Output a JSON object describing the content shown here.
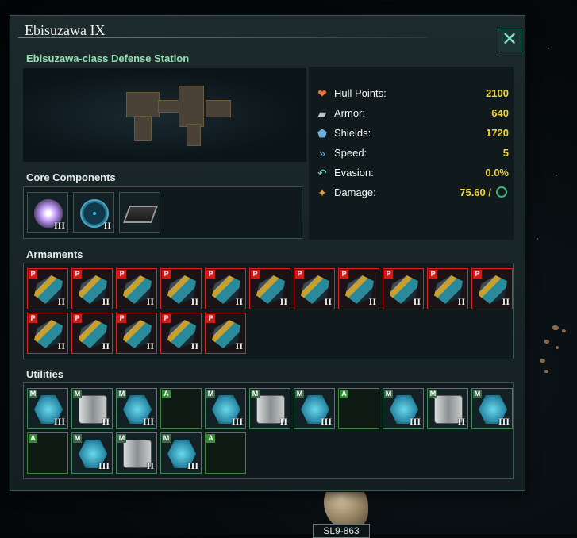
{
  "window": {
    "title": "Ebisuzawa IX",
    "close_label": "✕",
    "subtitle": "Ebisuzawa-class Defense Station"
  },
  "stats": [
    {
      "label": "Hull Points:",
      "value": "2100",
      "icon": "heart-icon",
      "glyph": "❤",
      "color": "#e8743a"
    },
    {
      "label": "Armor:",
      "value": "640",
      "icon": "armor-plate-icon",
      "glyph": "▰",
      "color": "#b8c4c4"
    },
    {
      "label": "Shields:",
      "value": "1720",
      "icon": "shield-icon",
      "glyph": "⬟",
      "color": "#6ab0d8"
    },
    {
      "label": "Speed:",
      "value": "5",
      "icon": "speed-icon",
      "glyph": "»",
      "color": "#8ab8e8"
    },
    {
      "label": "Evasion:",
      "value": "0.0%",
      "icon": "evasion-icon",
      "glyph": "↶",
      "color": "#6ad0b0"
    },
    {
      "label": "Damage:",
      "value": "75.60 /",
      "icon": "damage-icon",
      "glyph": "✦",
      "color": "#e8a040"
    }
  ],
  "sections": {
    "core": "Core Components",
    "armaments": "Armaments",
    "utilities": "Utilities"
  },
  "core_components": [
    {
      "icon": "reactor-icon",
      "tier": "III"
    },
    {
      "icon": "sensor-icon",
      "tier": "II"
    },
    {
      "icon": "computer-chip-icon",
      "tier": ""
    }
  ],
  "armaments": [
    {
      "badge": "P",
      "tier": "II"
    },
    {
      "badge": "P",
      "tier": "II"
    },
    {
      "badge": "P",
      "tier": "II"
    },
    {
      "badge": "P",
      "tier": "II"
    },
    {
      "badge": "P",
      "tier": "II"
    },
    {
      "badge": "P",
      "tier": "II"
    },
    {
      "badge": "P",
      "tier": "II"
    },
    {
      "badge": "P",
      "tier": "II"
    },
    {
      "badge": "P",
      "tier": "II"
    },
    {
      "badge": "P",
      "tier": "II"
    },
    {
      "badge": "P",
      "tier": "II"
    },
    {
      "badge": "P",
      "tier": "II"
    },
    {
      "badge": "P",
      "tier": "II"
    },
    {
      "badge": "P",
      "tier": "II"
    },
    {
      "badge": "P",
      "tier": "II"
    },
    {
      "badge": "P",
      "tier": "II"
    }
  ],
  "utilities": [
    {
      "badge": "M",
      "kind": "shield",
      "tier": "III"
    },
    {
      "badge": "M",
      "kind": "armor",
      "tier": "II"
    },
    {
      "badge": "M",
      "kind": "shield",
      "tier": "III"
    },
    {
      "badge": "A",
      "kind": "empty",
      "tier": ""
    },
    {
      "badge": "M",
      "kind": "shield",
      "tier": "III"
    },
    {
      "badge": "M",
      "kind": "armor",
      "tier": "II"
    },
    {
      "badge": "M",
      "kind": "shield",
      "tier": "III"
    },
    {
      "badge": "A",
      "kind": "empty",
      "tier": ""
    },
    {
      "badge": "M",
      "kind": "shield",
      "tier": "III"
    },
    {
      "badge": "M",
      "kind": "armor",
      "tier": "II"
    },
    {
      "badge": "M",
      "kind": "shield",
      "tier": "III"
    },
    {
      "badge": "A",
      "kind": "empty",
      "tier": ""
    },
    {
      "badge": "M",
      "kind": "shield",
      "tier": "III"
    },
    {
      "badge": "M",
      "kind": "armor",
      "tier": "II"
    },
    {
      "badge": "M",
      "kind": "shield",
      "tier": "III"
    },
    {
      "badge": "A",
      "kind": "empty",
      "tier": ""
    }
  ],
  "map": {
    "label": "SL9-863"
  },
  "colors": {
    "accent": "#8fe0b4",
    "value": "#f2d23a",
    "weapon_border": "#d22222"
  }
}
